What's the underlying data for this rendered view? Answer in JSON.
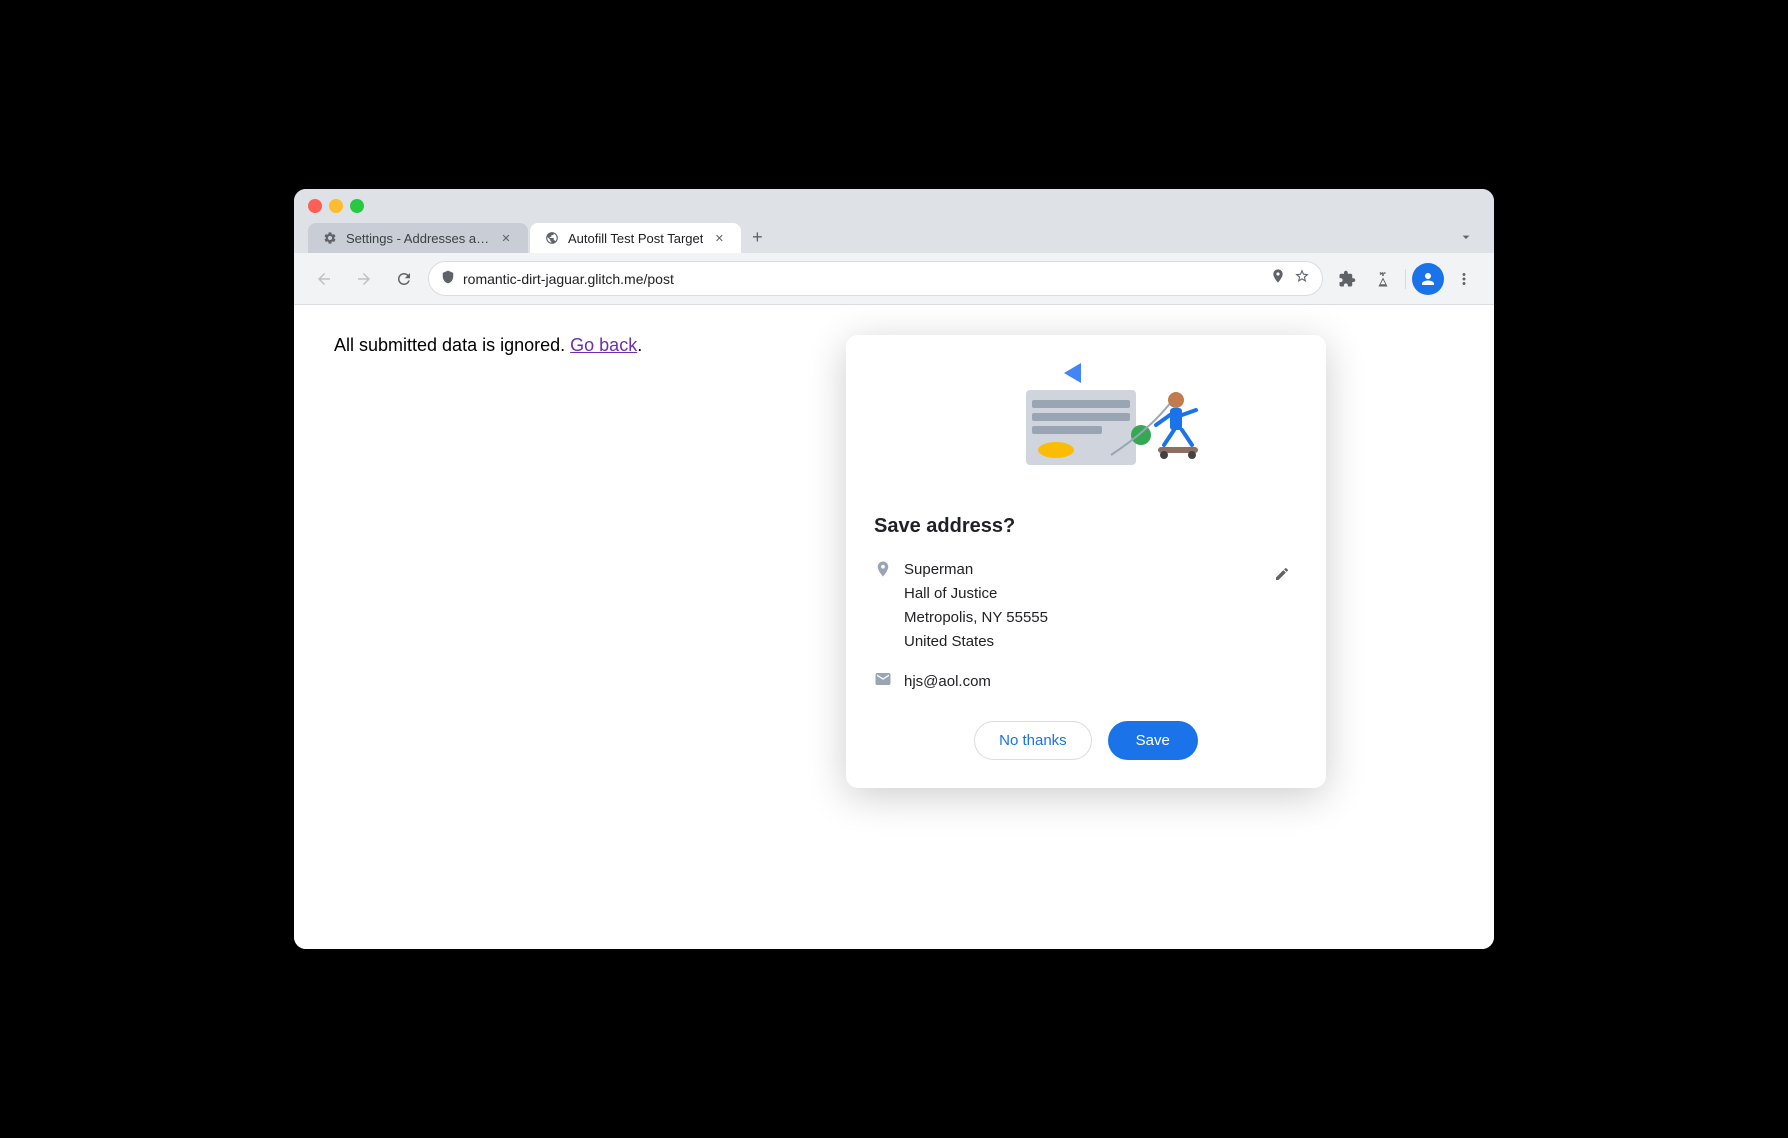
{
  "browser": {
    "tabs": [
      {
        "id": "tab-settings",
        "label": "Settings - Addresses and mo",
        "icon": "gear-icon",
        "active": false
      },
      {
        "id": "tab-autofill",
        "label": "Autofill Test Post Target",
        "icon": "globe-icon",
        "active": true
      }
    ],
    "new_tab_label": "+",
    "url": "romantic-dirt-jaguar.glitch.me/post",
    "back_tooltip": "Back",
    "forward_tooltip": "Forward",
    "reload_tooltip": "Reload"
  },
  "page": {
    "static_text": "All submitted data is ignored.",
    "link_text": "Go back",
    "link_suffix": "."
  },
  "dialog": {
    "title": "Save address?",
    "close_label": "×",
    "address": {
      "name": "Superman",
      "line1": "Hall of Justice",
      "line2": "Metropolis, NY 55555",
      "line3": "United States"
    },
    "email": "hjs@aol.com",
    "no_thanks_label": "No thanks",
    "save_label": "Save"
  }
}
